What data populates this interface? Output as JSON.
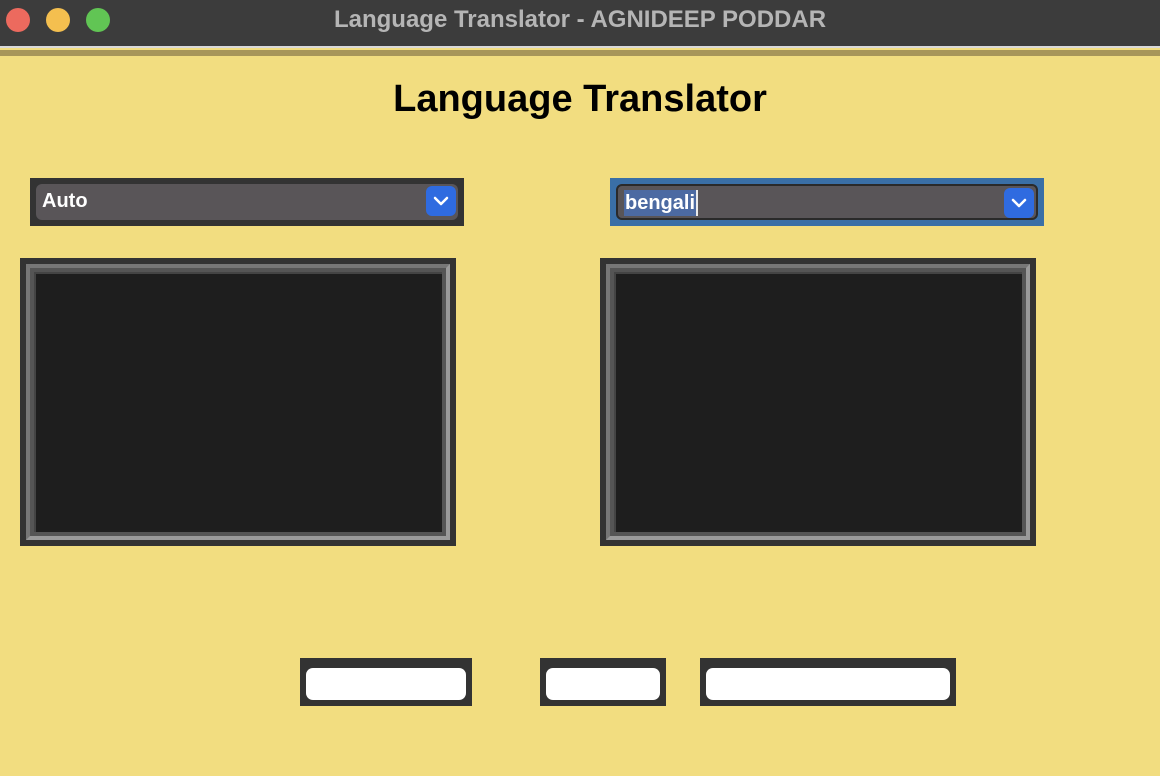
{
  "window": {
    "title": "Language Translator - AGNIDEEP PODDAR"
  },
  "app": {
    "heading": "Language Translator"
  },
  "source_language": {
    "selected": "Auto"
  },
  "target_language": {
    "selected": "bengali"
  },
  "input_text": {
    "value": ""
  },
  "output_text": {
    "value": ""
  },
  "buttons": {
    "button1_label": "",
    "button2_label": "",
    "button3_label": ""
  },
  "colors": {
    "background": "#f2dd80",
    "titlebar": "#3c3c3c",
    "dropdown_accent": "#2f6be0",
    "text_area": "#1e1e1e"
  },
  "icons": {
    "dropdown": "chevron-down-icon",
    "close": "close-window-icon",
    "minimize": "minimize-window-icon",
    "maximize": "maximize-window-icon"
  }
}
